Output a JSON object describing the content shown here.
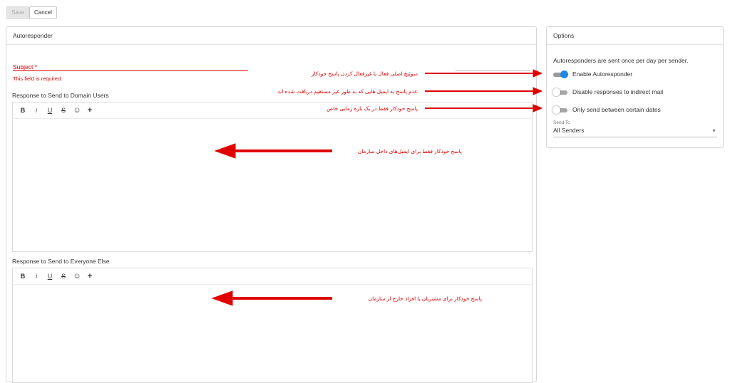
{
  "toolbar": {
    "save_label": "Save",
    "cancel_label": "Cancel"
  },
  "autoresponder": {
    "title": "Autoresponder",
    "subject_label": "Subject *",
    "subject_error": "This field is required.",
    "domain_label": "Response to Send to Domain Users",
    "everyone_label": "Response to Send to Everyone Else",
    "editor_tools": {
      "bold": "B",
      "italic": "i",
      "underline": "U",
      "strike": "S",
      "emoji": "☺",
      "insert": "+"
    }
  },
  "options": {
    "title": "Options",
    "info": "Autoresponders are sent once per day per sender.",
    "toggles": [
      {
        "label": "Enable Autoresponder",
        "on": true
      },
      {
        "label": "Disable responses to indirect mail",
        "on": false
      },
      {
        "label": "Only send between certain dates",
        "on": false
      }
    ],
    "send_to_label": "Send To",
    "send_to_value": "All Senders"
  },
  "annotations": {
    "enable": "سوئیچ اصلی فعال یا غیرفعال کردن پاسخ خودکار",
    "indirect": "عدم پاسخ به ایمیل هایی که به طور غیر مستقیم دریافت شده اند",
    "dates": "پاسخ خودکار فقط در یک بازه زمانی خاص",
    "domain": "پاسخ خودکار فقط برای ایمیل‌های داخل سازمان",
    "everyone": "پاسخ خودکار برای مشتریان یا افراد خارج از سازمان"
  },
  "colors": {
    "accent": "#1e88e5",
    "error": "#e00000"
  }
}
